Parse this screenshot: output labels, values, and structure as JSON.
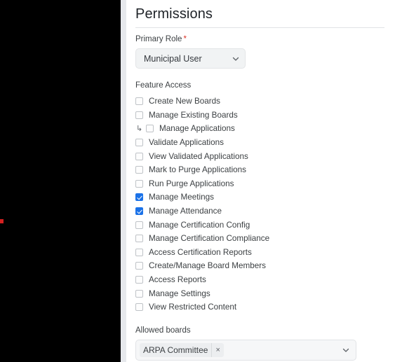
{
  "window": {
    "left_panel_color": "#000000",
    "gutter_color": "#e6e8ec",
    "marker_color": "#d32020"
  },
  "panel": {
    "title": "Permissions",
    "primary_role": {
      "label": "Primary Role",
      "required_marker": "*",
      "selected_value": "Municipal User",
      "chevron_icon": "chevron-down-icon"
    },
    "feature_access": {
      "label": "Feature Access",
      "items": [
        {
          "label": "Create New Boards",
          "checked": false,
          "indented": false
        },
        {
          "label": "Manage Existing Boards",
          "checked": false,
          "indented": false
        },
        {
          "label": "Manage Applications",
          "checked": false,
          "indented": true,
          "arrow": "↳"
        },
        {
          "label": "Validate Applications",
          "checked": false,
          "indented": false
        },
        {
          "label": "View Validated Applications",
          "checked": false,
          "indented": false
        },
        {
          "label": "Mark to Purge Applications",
          "checked": false,
          "indented": false
        },
        {
          "label": "Run Purge Applications",
          "checked": false,
          "indented": false
        },
        {
          "label": "Manage Meetings",
          "checked": true,
          "indented": false
        },
        {
          "label": "Manage Attendance",
          "checked": true,
          "indented": false
        },
        {
          "label": "Manage Certification Config",
          "checked": false,
          "indented": false
        },
        {
          "label": "Manage Certification Compliance",
          "checked": false,
          "indented": false
        },
        {
          "label": "Access Certification Reports",
          "checked": false,
          "indented": false
        },
        {
          "label": "Create/Manage Board Members",
          "checked": false,
          "indented": false
        },
        {
          "label": "Access Reports",
          "checked": false,
          "indented": false
        },
        {
          "label": "Manage Settings",
          "checked": false,
          "indented": false
        },
        {
          "label": "View Restricted Content",
          "checked": false,
          "indented": false
        }
      ]
    },
    "allowed_boards": {
      "label": "Allowed boards",
      "chips": [
        {
          "label": "ARPA Committee",
          "remove_label": "×"
        }
      ],
      "chevron_icon": "chevron-down-icon"
    }
  },
  "colors": {
    "checkbox_checked": "#1b72e8",
    "required_star": "#d93025",
    "text": "#3c4043"
  }
}
